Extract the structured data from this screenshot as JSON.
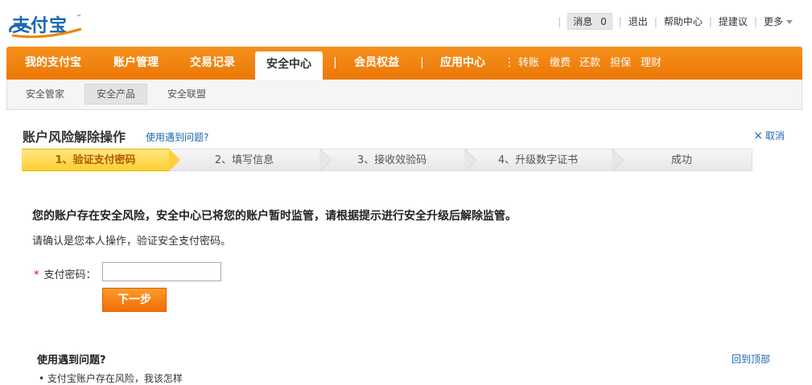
{
  "logo": {
    "text": "支付宝",
    "tm": "™"
  },
  "topbar": {
    "message_label": "消息",
    "message_count": "0",
    "logout": "退出",
    "help_center": "帮助中心",
    "suggest": "提建议",
    "more": "更多"
  },
  "mainnav": {
    "items": [
      "我的支付宝",
      "账户管理",
      "交易记录",
      "安全中心",
      "会员权益",
      "应用中心"
    ],
    "active": "安全中心",
    "quick_links": [
      "转账",
      "缴费",
      "还款",
      "担保",
      "理财"
    ]
  },
  "subnav": {
    "items": [
      "安全管家",
      "安全产品",
      "安全联盟"
    ],
    "active": "安全产品"
  },
  "page": {
    "title": "账户风险解除操作",
    "help_link": "使用遇到问题?",
    "cancel": "取消"
  },
  "steps": [
    "1、验证支付密码",
    "2、填写信息",
    "3、接收效验码",
    "4、升级数字证书",
    "成功"
  ],
  "content": {
    "notice": "您的账户存在安全风险，安全中心已将您的账户暂时监管，请根据提示进行安全升级后解除监管。",
    "confirm": "请确认是您本人操作，验证安全支付密码。",
    "password_label": "支付密码：",
    "required_mark": "*",
    "next_button": "下一步"
  },
  "faq": {
    "title": "使用遇到问题?",
    "back_to_top": "回到顶部",
    "first_item": "• 支付宝账户存在风险，我该怎样"
  },
  "colors": {
    "brand_orange": "#f08300",
    "link_blue": "#1a66b3",
    "step_active": "#ffd033"
  }
}
